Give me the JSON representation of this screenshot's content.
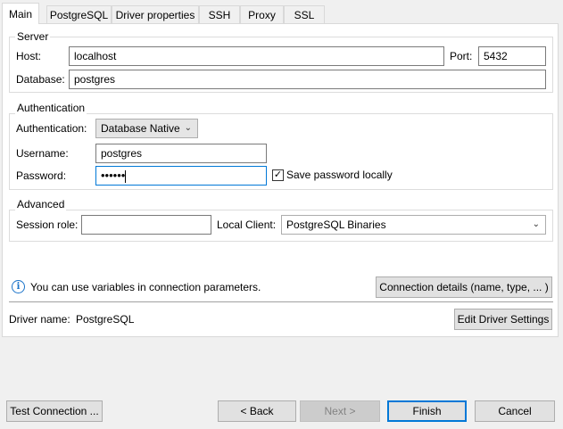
{
  "tabs": [
    {
      "label": "Main",
      "active": true
    },
    {
      "label": "PostgreSQL"
    },
    {
      "label": "Driver properties"
    },
    {
      "label": "SSH"
    },
    {
      "label": "Proxy"
    },
    {
      "label": "SSL"
    }
  ],
  "server": {
    "legend": "Server",
    "host_label": "Host:",
    "host_value": "localhost",
    "port_label": "Port:",
    "port_value": "5432",
    "database_label": "Database:",
    "database_value": "postgres"
  },
  "authentication": {
    "legend": "Authentication",
    "auth_label": "Authentication:",
    "auth_value": "Database Native",
    "username_label": "Username:",
    "username_value": "postgres",
    "password_label": "Password:",
    "password_value": "••••••",
    "save_password_label": "Save password locally",
    "save_password_checked": true
  },
  "advanced": {
    "legend": "Advanced",
    "session_role_label": "Session role:",
    "session_role_value": "",
    "local_client_label": "Local Client:",
    "local_client_value": "PostgreSQL Binaries"
  },
  "info_text": "You can use variables in connection parameters.",
  "connection_details_button": "Connection details (name, type, ... )",
  "driver": {
    "label": "Driver name:",
    "value": "PostgreSQL",
    "edit_button": "Edit Driver Settings"
  },
  "footer": {
    "test_connection": "Test Connection ...",
    "back": "< Back",
    "next": "Next >",
    "finish": "Finish",
    "cancel": "Cancel"
  },
  "colors": {
    "focus_border": "#0078d7",
    "info_icon": "#1a73c9"
  }
}
